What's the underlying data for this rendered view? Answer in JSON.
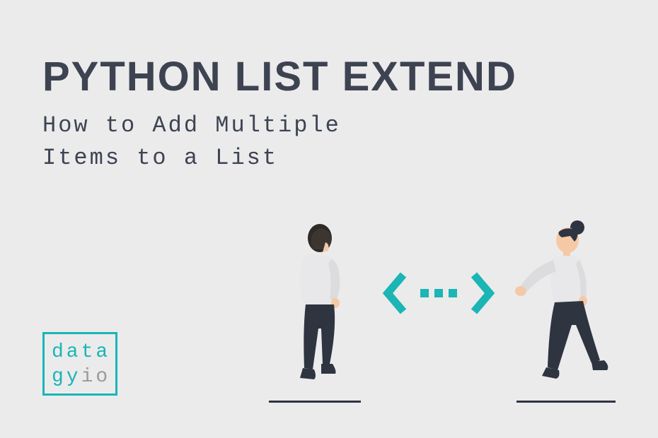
{
  "title": "PYTHON LIST EXTEND",
  "subtitle_line1": "How to Add Multiple",
  "subtitle_line2": "Items to a List",
  "logo": {
    "line1_teal": "data",
    "line2_teal": "gy",
    "line2_grey": "io"
  },
  "colors": {
    "accent": "#1bb5b5",
    "text": "#3d4351",
    "bg": "#ebebec"
  }
}
